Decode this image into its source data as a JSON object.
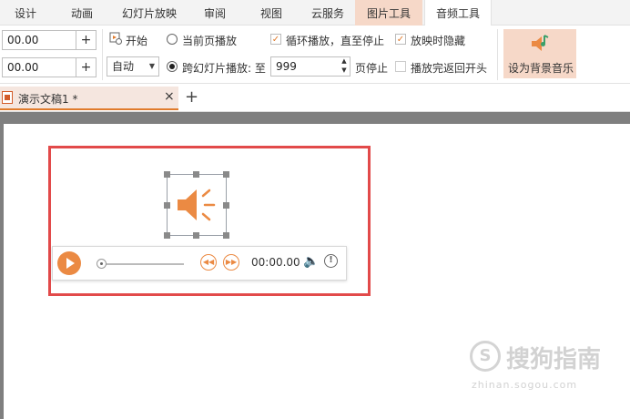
{
  "tabs": [
    {
      "label": "设计"
    },
    {
      "label": "动画"
    },
    {
      "label": "幻灯片放映"
    },
    {
      "label": "审阅"
    },
    {
      "label": "视图"
    },
    {
      "label": "云服务"
    },
    {
      "label": "图片工具"
    },
    {
      "label": "音频工具"
    }
  ],
  "ribbon": {
    "fade_in_value": "00.00",
    "fade_out_value": "00.00",
    "start_label": "开始",
    "start_select_value": "自动",
    "current_page_label": "当前页播放",
    "cross_slide_label": "跨幻灯片播放: 至",
    "cross_slide_value": "999",
    "page_stop_label": "页停止",
    "loop_label": "循环播放，直至停止",
    "hide_label": "放映时隐藏",
    "rewind_label": "播放完返回开头",
    "bg_music_label": "设为背景音乐"
  },
  "document": {
    "tab_label": "演示文稿1 *",
    "close_glyph": "×",
    "new_tab_glyph": "+"
  },
  "player": {
    "time": "00:00.00"
  },
  "watermark": {
    "text": "搜狗指南",
    "logo": "S",
    "url": "zhinan.sogou.com"
  },
  "colors": {
    "accent": "#eb8a43",
    "highlight": "#e24a4a",
    "active_tab_bg": "#f6d8c8"
  }
}
